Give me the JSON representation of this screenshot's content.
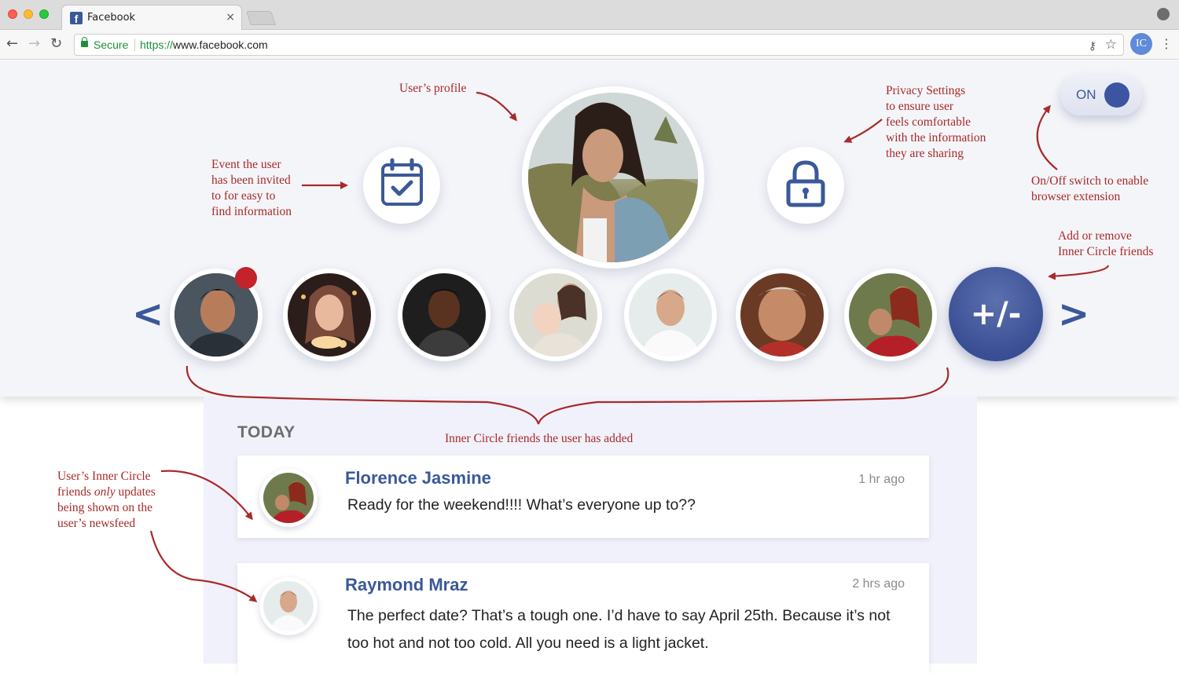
{
  "browser": {
    "tab_title": "Facebook",
    "tab_close": "×",
    "secure_label": "Secure",
    "url_scheme": "https://",
    "url_host": "www.facebook.com",
    "profile_initials": "IC",
    "icons": [
      "back-icon",
      "forward-icon",
      "reload-icon",
      "lock-icon",
      "key-icon",
      "star-icon",
      "menu-icon"
    ]
  },
  "toggle": {
    "label": "ON",
    "state": "on"
  },
  "inner_circle": {
    "add_remove_label": "+/-",
    "prev_label": "<",
    "next_label": ">",
    "friend_count": 7
  },
  "annotations": {
    "profile": "User’s profile",
    "event": "Event the user\nhas been invited\nto for easy to\nfind information",
    "privacy": "Privacy Settings\nto ensure user\nfeels comfortable\nwith the information\nthey are sharing",
    "switch": "On/Off switch to enable\nbrowser extension",
    "add_remove": "Add or remove\nInner Circle friends",
    "inner_circle": "Inner Circle friends the user has added",
    "newsfeed_a": "User’s Inner Circle\nfriends ",
    "newsfeed_only": "only",
    "newsfeed_b": " updates\nbeing shown on the\nuser’s newsfeed"
  },
  "feed": {
    "section_label": "TODAY",
    "posts": [
      {
        "author": "Florence Jasmine",
        "time": "1 hr ago",
        "text": "Ready for the weekend!!!! What’s everyone up to??"
      },
      {
        "author": "Raymond Mraz",
        "time": "2 hrs ago",
        "text": "The perfect date? That’s a tough one. I’d have to say April 25th. Because it’s not too hot and not too cold. All you need is a light jacket."
      }
    ]
  },
  "colors": {
    "brand_blue": "#3b5998",
    "annotation_red": "#a82a2a",
    "notification_red": "#c3232b",
    "secure_green": "#1e8e3e"
  }
}
